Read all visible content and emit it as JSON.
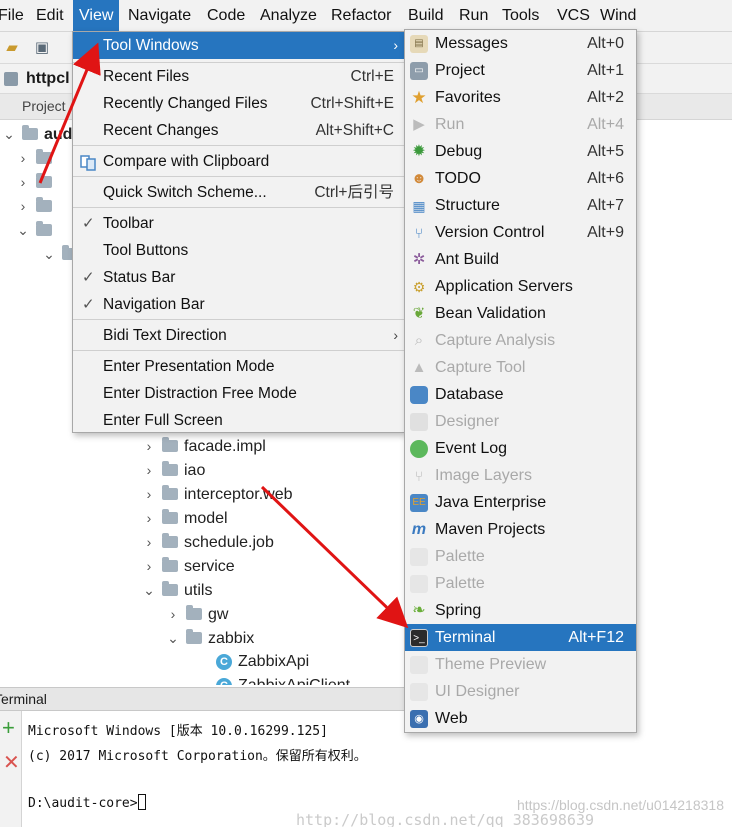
{
  "menubar": {
    "items": [
      "File",
      "Edit",
      "View",
      "Navigate",
      "Code",
      "Analyze",
      "Refactor",
      "Build",
      "Run",
      "Tools",
      "VCS",
      "Wind"
    ]
  },
  "navbar": {
    "project_name": "httpcl"
  },
  "project_panel": {
    "title": "Project"
  },
  "tree": {
    "root_label": "aud",
    "items": [
      {
        "label": "facade.impl",
        "kind": "folder",
        "expanded": false
      },
      {
        "label": "iao",
        "kind": "folder",
        "expanded": false
      },
      {
        "label": "interceptor.web",
        "kind": "folder",
        "expanded": false
      },
      {
        "label": "model",
        "kind": "folder",
        "expanded": false
      },
      {
        "label": "schedule.job",
        "kind": "folder",
        "expanded": false
      },
      {
        "label": "service",
        "kind": "folder",
        "expanded": false
      },
      {
        "label": "utils",
        "kind": "folder",
        "expanded": true
      },
      {
        "label": "gw",
        "kind": "folder",
        "expanded": false
      },
      {
        "label": "zabbix",
        "kind": "folder",
        "expanded": true
      },
      {
        "label": "ZabbixApi",
        "kind": "class"
      },
      {
        "label": "ZabbixApiClient",
        "kind": "class"
      }
    ]
  },
  "view_menu": {
    "items": [
      {
        "label": "Tool Windows",
        "shortcut": "",
        "submenu": true,
        "highlighted": true
      },
      {
        "label": "Recent Files",
        "shortcut": "Ctrl+E"
      },
      {
        "label": "Recently Changed Files",
        "shortcut": "Ctrl+Shift+E"
      },
      {
        "label": "Recent Changes",
        "shortcut": "Alt+Shift+C"
      },
      {
        "label": "Compare with Clipboard",
        "shortcut": ""
      },
      {
        "label": "Quick Switch Scheme...",
        "shortcut": "Ctrl+后引号"
      },
      {
        "label": "Toolbar",
        "checked": true
      },
      {
        "label": "Tool Buttons",
        "checked": false
      },
      {
        "label": "Status Bar",
        "checked": true
      },
      {
        "label": "Navigation Bar",
        "checked": true
      },
      {
        "label": "Bidi Text Direction",
        "submenu": true
      },
      {
        "label": "Enter Presentation Mode"
      },
      {
        "label": "Enter Distraction Free Mode"
      },
      {
        "label": "Enter Full Screen"
      }
    ]
  },
  "tool_windows_menu": {
    "items": [
      {
        "label": "Messages",
        "shortcut": "Alt+0",
        "icon": "messages-icon"
      },
      {
        "label": "Project",
        "shortcut": "Alt+1",
        "icon": "project-icon"
      },
      {
        "label": "Favorites",
        "shortcut": "Alt+2",
        "icon": "star-icon"
      },
      {
        "label": "Run",
        "shortcut": "Alt+4",
        "icon": "run-icon",
        "disabled": true
      },
      {
        "label": "Debug",
        "shortcut": "Alt+5",
        "icon": "debug-icon"
      },
      {
        "label": "TODO",
        "shortcut": "Alt+6",
        "icon": "todo-icon"
      },
      {
        "label": "Structure",
        "shortcut": "Alt+7",
        "icon": "structure-icon"
      },
      {
        "label": "Version Control",
        "shortcut": "Alt+9",
        "icon": "version-control-icon"
      },
      {
        "label": "Ant Build",
        "shortcut": "",
        "icon": "ant-icon"
      },
      {
        "label": "Application Servers",
        "shortcut": "",
        "icon": "app-servers-icon"
      },
      {
        "label": "Bean Validation",
        "shortcut": "",
        "icon": "bean-icon"
      },
      {
        "label": "Capture Analysis",
        "shortcut": "",
        "icon": "capture-analysis-icon",
        "disabled": true
      },
      {
        "label": "Capture Tool",
        "shortcut": "",
        "icon": "capture-tool-icon",
        "disabled": true
      },
      {
        "label": "Database",
        "shortcut": "",
        "icon": "database-icon"
      },
      {
        "label": "Designer",
        "shortcut": "",
        "icon": "designer-icon",
        "disabled": true
      },
      {
        "label": "Event Log",
        "shortcut": "",
        "icon": "event-log-icon"
      },
      {
        "label": "Image Layers",
        "shortcut": "",
        "icon": "image-layers-icon",
        "disabled": true
      },
      {
        "label": "Java Enterprise",
        "shortcut": "",
        "icon": "java-enterprise-icon"
      },
      {
        "label": "Maven Projects",
        "shortcut": "",
        "icon": "maven-icon"
      },
      {
        "label": "Palette",
        "shortcut": "",
        "icon": "palette-icon",
        "disabled": true
      },
      {
        "label": "Palette",
        "shortcut": "",
        "icon": "palette-icon",
        "disabled": true
      },
      {
        "label": "Spring",
        "shortcut": "",
        "icon": "spring-icon"
      },
      {
        "label": "Terminal",
        "shortcut": "Alt+F12",
        "icon": "terminal-icon",
        "highlighted": true
      },
      {
        "label": "Theme Preview",
        "shortcut": "",
        "icon": "theme-preview-icon",
        "disabled": true
      },
      {
        "label": "UI Designer",
        "shortcut": "",
        "icon": "ui-designer-icon",
        "disabled": true
      },
      {
        "label": "Web",
        "shortcut": "",
        "icon": "web-icon"
      }
    ]
  },
  "terminal": {
    "title": "Terminal",
    "lines": [
      "Microsoft Windows [版本 10.0.16299.125]",
      "(c) 2017 Microsoft Corporation。保留所有权利。",
      "",
      "D:\\audit-core>"
    ]
  },
  "watermark": {
    "text1": "https://blog.csdn.net/u014218318",
    "text2": "http://blog.csdn.net/qq_383698639"
  },
  "colors": {
    "highlight": "#2675bf",
    "menu_bg": "#f2f2f2",
    "disabled_text": "#a9a9a9",
    "annotation_arrow": "#e01414"
  }
}
